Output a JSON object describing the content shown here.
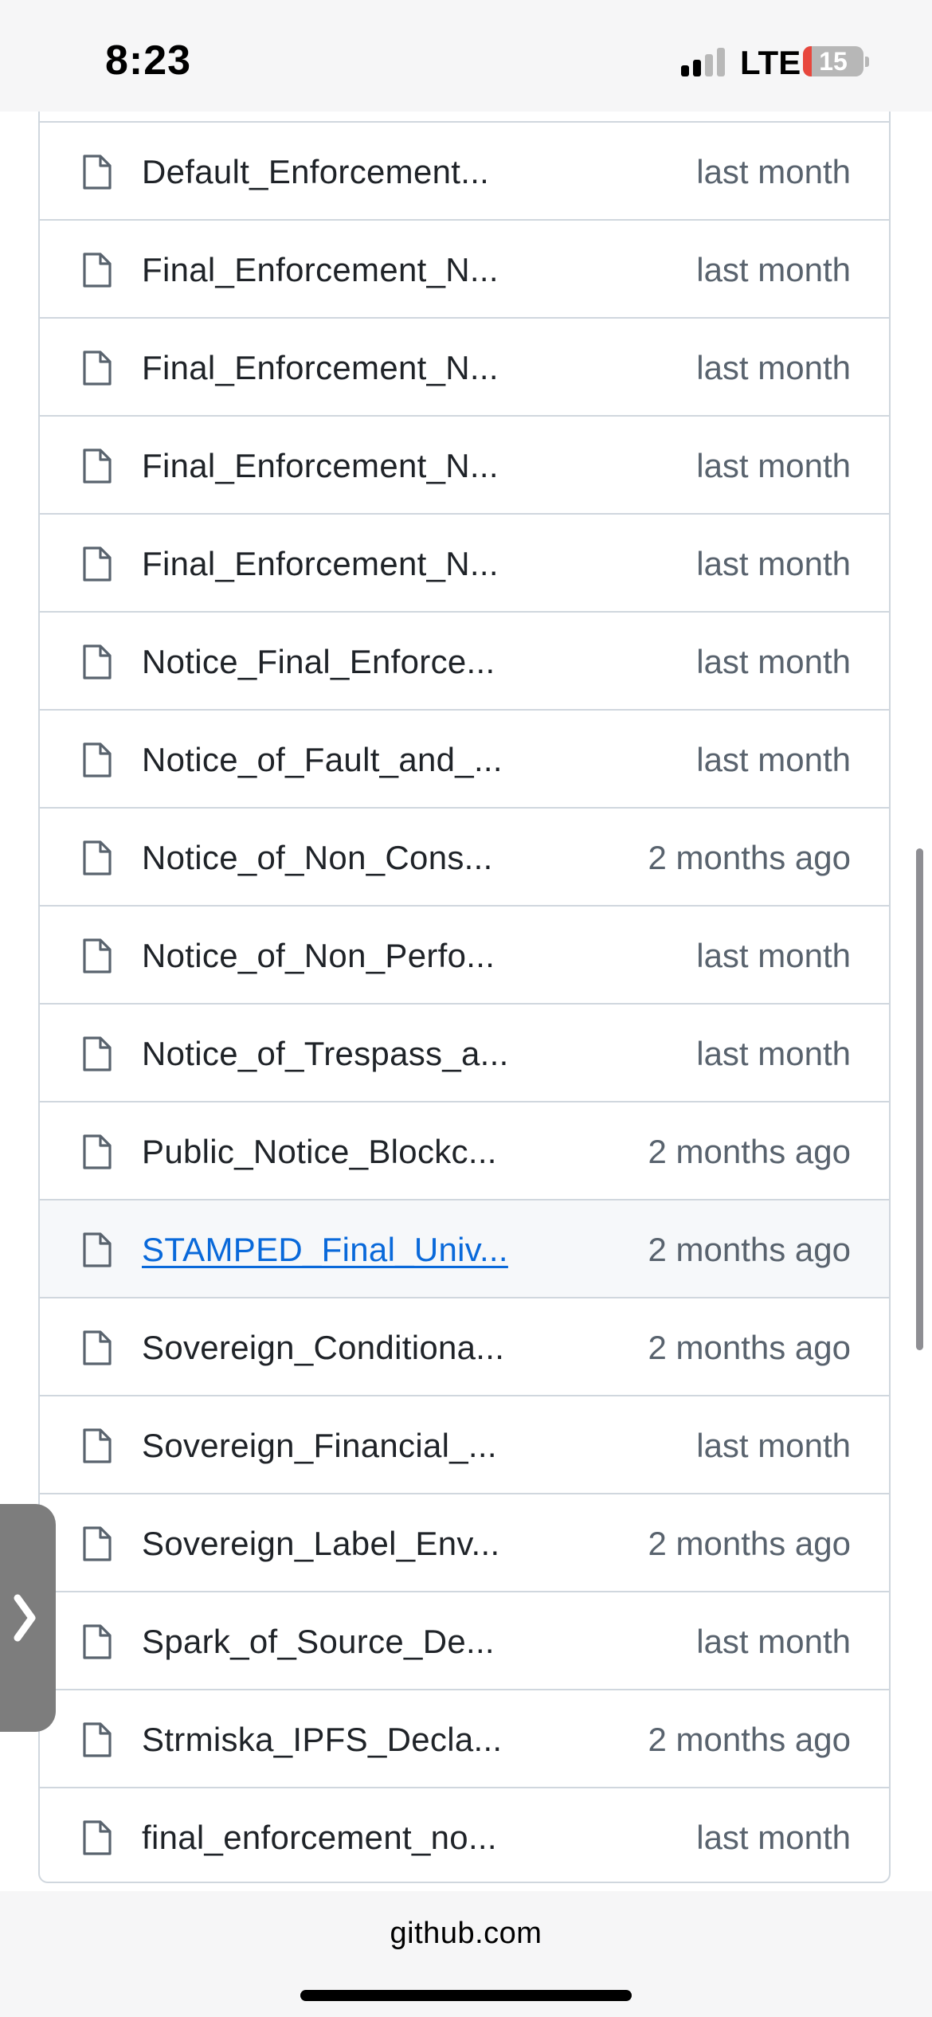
{
  "status_bar": {
    "time": "8:23",
    "network": "LTE",
    "battery_level": "15",
    "battery_fraction": 0.15,
    "signal_bars_active": 2,
    "signal_bars_total": 4
  },
  "files": [
    {
      "name": "Default_Enforcement...",
      "date": "last month",
      "icon": "file-icon"
    },
    {
      "name": "Final_Enforcement_N...",
      "date": "last month",
      "icon": "file-icon"
    },
    {
      "name": "Final_Enforcement_N...",
      "date": "last month",
      "icon": "file-icon"
    },
    {
      "name": "Final_Enforcement_N...",
      "date": "last month",
      "icon": "file-icon"
    },
    {
      "name": "Final_Enforcement_N...",
      "date": "last month",
      "icon": "file-icon"
    },
    {
      "name": "Notice_Final_Enforce...",
      "date": "last month",
      "icon": "file-icon"
    },
    {
      "name": "Notice_of_Fault_and_...",
      "date": "last month",
      "icon": "file-icon"
    },
    {
      "name": "Notice_of_Non_Cons...",
      "date": "2 months ago",
      "icon": "file-icon"
    },
    {
      "name": "Notice_of_Non_Perfo...",
      "date": "last month",
      "icon": "file-icon"
    },
    {
      "name": "Notice_of_Trespass_a...",
      "date": "last month",
      "icon": "file-icon"
    },
    {
      "name": "Public_Notice_Blockc...",
      "date": "2 months ago",
      "icon": "file-icon"
    },
    {
      "name": "STAMPED_Final_Univ...",
      "date": "2 months ago",
      "icon": "file-icon",
      "highlighted": true
    },
    {
      "name": "Sovereign_Conditiona...",
      "date": "2 months ago",
      "icon": "file-icon"
    },
    {
      "name": "Sovereign_Financial_...",
      "date": "last month",
      "icon": "file-icon"
    },
    {
      "name": "Sovereign_Label_Env...",
      "date": "2 months ago",
      "icon": "file-icon"
    },
    {
      "name": "Spark_of_Source_De...",
      "date": "last month",
      "icon": "file-icon"
    },
    {
      "name": "Strmiska_IPFS_Decla...",
      "date": "2 months ago",
      "icon": "file-icon"
    },
    {
      "name": "final_enforcement_no...",
      "date": "last month",
      "icon": "file-icon"
    }
  ],
  "browser": {
    "url": "github.com"
  },
  "side_tab": {
    "icon": "chevron-right-icon"
  },
  "colors": {
    "link": "#0969da",
    "text": "#1f2328",
    "muted": "#59636e",
    "border": "#d0d7de",
    "highlight_bg": "#f6f8fa",
    "battery_low": "#e8473d"
  }
}
